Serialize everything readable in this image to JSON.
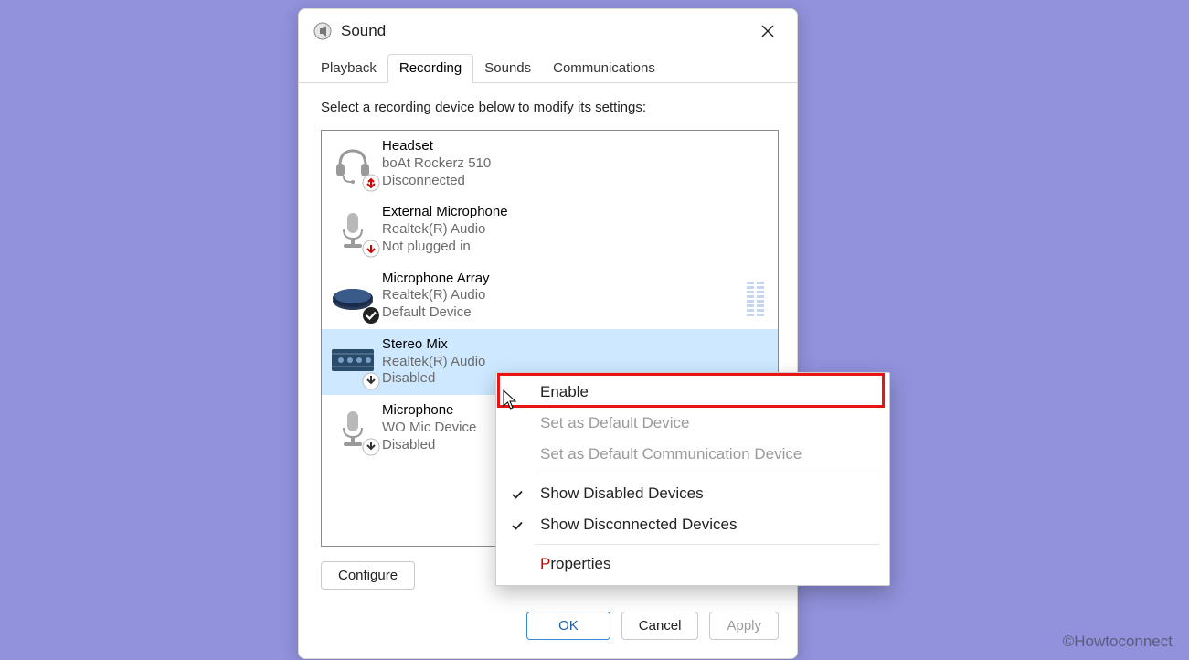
{
  "window": {
    "title": "Sound",
    "tabs": {
      "playback": "Playback",
      "recording": "Recording",
      "sounds": "Sounds",
      "communications": "Communications"
    },
    "active_tab": "recording",
    "instruction": "Select a recording device below to modify its settings:",
    "buttons": {
      "configure": "Configure",
      "ok": "OK",
      "cancel": "Cancel",
      "apply": "Apply"
    }
  },
  "devices": [
    {
      "name": "Headset",
      "subtitle": "boAt Rockerz 510",
      "status": "Disconnected",
      "icon": "headset",
      "badge": "disconnected"
    },
    {
      "name": "External Microphone",
      "subtitle": "Realtek(R) Audio",
      "status": "Not plugged in",
      "icon": "microphone",
      "badge": "unplugged"
    },
    {
      "name": "Microphone Array",
      "subtitle": "Realtek(R) Audio",
      "status": "Default Device",
      "icon": "mic-array",
      "badge": "default",
      "meter": true
    },
    {
      "name": "Stereo Mix",
      "subtitle": "Realtek(R) Audio",
      "status": "Disabled",
      "icon": "sound-card",
      "badge": "disabled",
      "selected": true
    },
    {
      "name": "Microphone",
      "subtitle": "WO Mic Device",
      "status": "Disabled",
      "icon": "microphone",
      "badge": "disabled"
    }
  ],
  "context_menu": {
    "items": {
      "enable": "Enable",
      "set_default": "Set as Default Device",
      "set_default_comm": "Set as Default Communication Device",
      "show_disabled": "Show Disabled Devices",
      "show_disconnected": "Show Disconnected Devices",
      "properties": "Properties"
    },
    "checked": [
      "show_disabled",
      "show_disconnected"
    ],
    "disabled": [
      "set_default",
      "set_default_comm"
    ]
  },
  "watermark": "©Howtoconnect"
}
